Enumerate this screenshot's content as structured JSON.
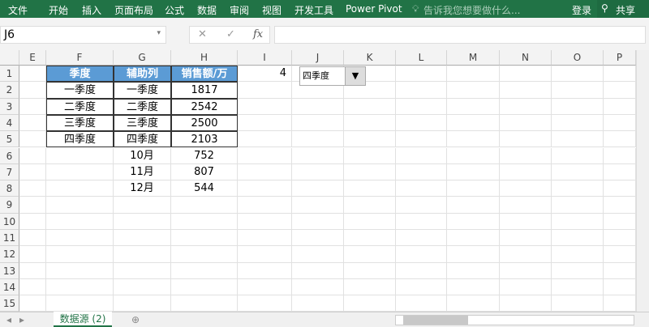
{
  "ribbon": {
    "tabs": [
      "文件",
      "开始",
      "插入",
      "页面布局",
      "公式",
      "数据",
      "审阅",
      "视图",
      "开发工具",
      "Power Pivot"
    ],
    "tell_me": "告诉我您想要做什么...",
    "login": "登录",
    "share": "共享"
  },
  "formula": {
    "name_box": "J6",
    "cancel": "✕",
    "enter": "✓",
    "fx": "fx",
    "value": ""
  },
  "columns": [
    "E",
    "F",
    "G",
    "H",
    "I",
    "J",
    "K",
    "L",
    "M",
    "N",
    "O",
    "P"
  ],
  "rows": [
    "1",
    "2",
    "3",
    "4",
    "5",
    "6",
    "7",
    "8",
    "9",
    "10",
    "11",
    "12",
    "13",
    "14",
    "15"
  ],
  "table": {
    "headers": [
      "季度",
      "辅助列",
      "销售额/万"
    ],
    "data": [
      [
        "一季度",
        "一季度",
        "1817"
      ],
      [
        "二季度",
        "二季度",
        "2542"
      ],
      [
        "三季度",
        "三季度",
        "2500"
      ],
      [
        "四季度",
        "四季度",
        "2103"
      ],
      [
        "",
        "10月",
        "752"
      ],
      [
        "",
        "11月",
        "807"
      ],
      [
        "",
        "12月",
        "544"
      ]
    ]
  },
  "i1": "4",
  "dropdown": {
    "value": "四季度"
  },
  "sheet_tab": "数据源 (2)",
  "colors": {
    "ribbon": "#217346",
    "header_fill": "#5b9bd5"
  }
}
